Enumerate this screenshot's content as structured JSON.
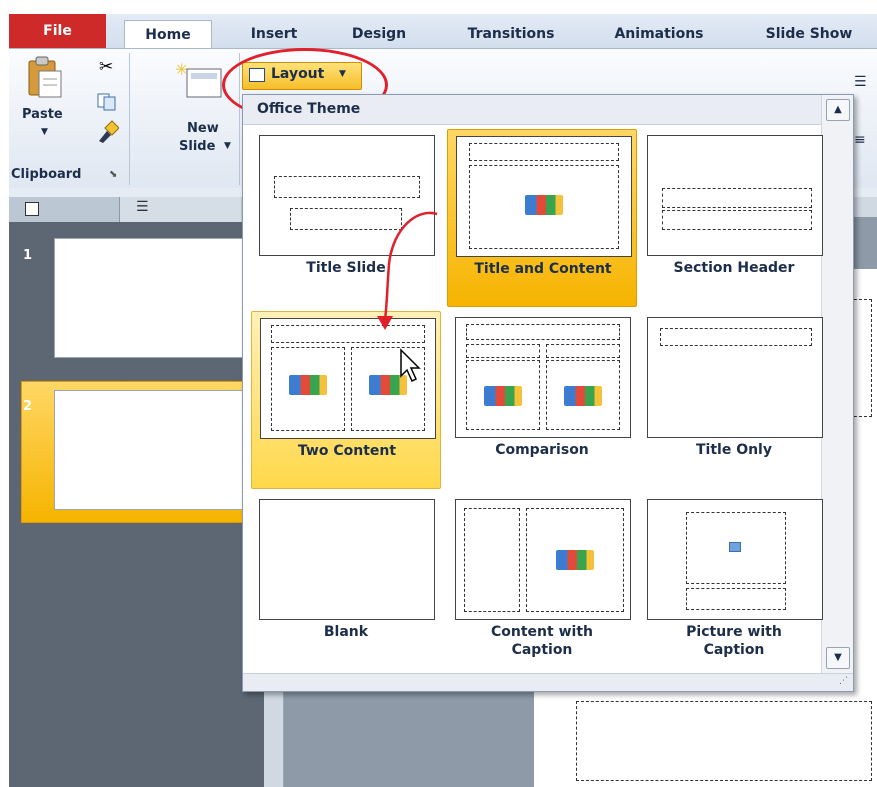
{
  "tabs": {
    "file": "File",
    "home": "Home",
    "insert": "Insert",
    "design": "Design",
    "transitions": "Transitions",
    "animations": "Animations",
    "slideshow": "Slide Show"
  },
  "ribbon": {
    "paste": "Paste",
    "new_slide": "New",
    "new_slide_line2": "Slide",
    "clipboard": "Clipboard",
    "layout_button": "Layout"
  },
  "dropdown": {
    "header": "Office Theme",
    "layouts": [
      {
        "label": "Title Slide"
      },
      {
        "label": "Title and Content"
      },
      {
        "label": "Section Header"
      },
      {
        "label": "Two Content"
      },
      {
        "label": "Comparison"
      },
      {
        "label": "Title Only"
      },
      {
        "label": "Blank"
      },
      {
        "label": "Content with Caption"
      },
      {
        "label": "Picture with Caption"
      }
    ]
  },
  "slides": [
    {
      "number": "1"
    },
    {
      "number": "2"
    }
  ],
  "colors": {
    "file_tab": "#cf2a2a",
    "selected": "#f6b400",
    "annotation": "#e0202a"
  }
}
